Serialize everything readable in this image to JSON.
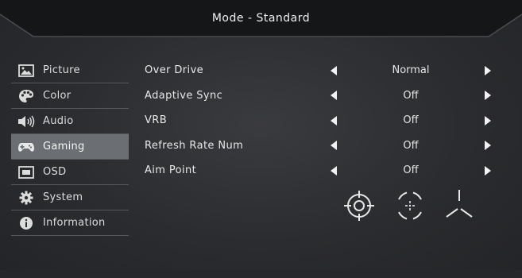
{
  "header": {
    "title": "Mode - Standard"
  },
  "sidebar": {
    "items": [
      {
        "label": "Picture",
        "icon": "picture-icon"
      },
      {
        "label": "Color",
        "icon": "palette-icon"
      },
      {
        "label": "Audio",
        "icon": "speaker-icon"
      },
      {
        "label": "Gaming",
        "icon": "gamepad-icon",
        "active": true
      },
      {
        "label": "OSD",
        "icon": "osd-icon"
      },
      {
        "label": "System",
        "icon": "gear-icon"
      },
      {
        "label": "Information",
        "icon": "info-icon"
      }
    ]
  },
  "settings": [
    {
      "label": "Over  Drive",
      "value": "Normal"
    },
    {
      "label": "Adaptive Sync",
      "value": "Off"
    },
    {
      "label": "VRB",
      "value": "Off"
    },
    {
      "label": "Refresh  Rate  Num",
      "value": "Off"
    },
    {
      "label": "Aim  Point",
      "value": "Off"
    }
  ],
  "aim_point_options": [
    "crosshair-circle-icon",
    "crosshair-dot-icon",
    "crosshair-lines-icon"
  ],
  "colors": {
    "active_bg": "#6b6e72",
    "text": "#e6e6e6",
    "background": "#2b2c2f"
  }
}
